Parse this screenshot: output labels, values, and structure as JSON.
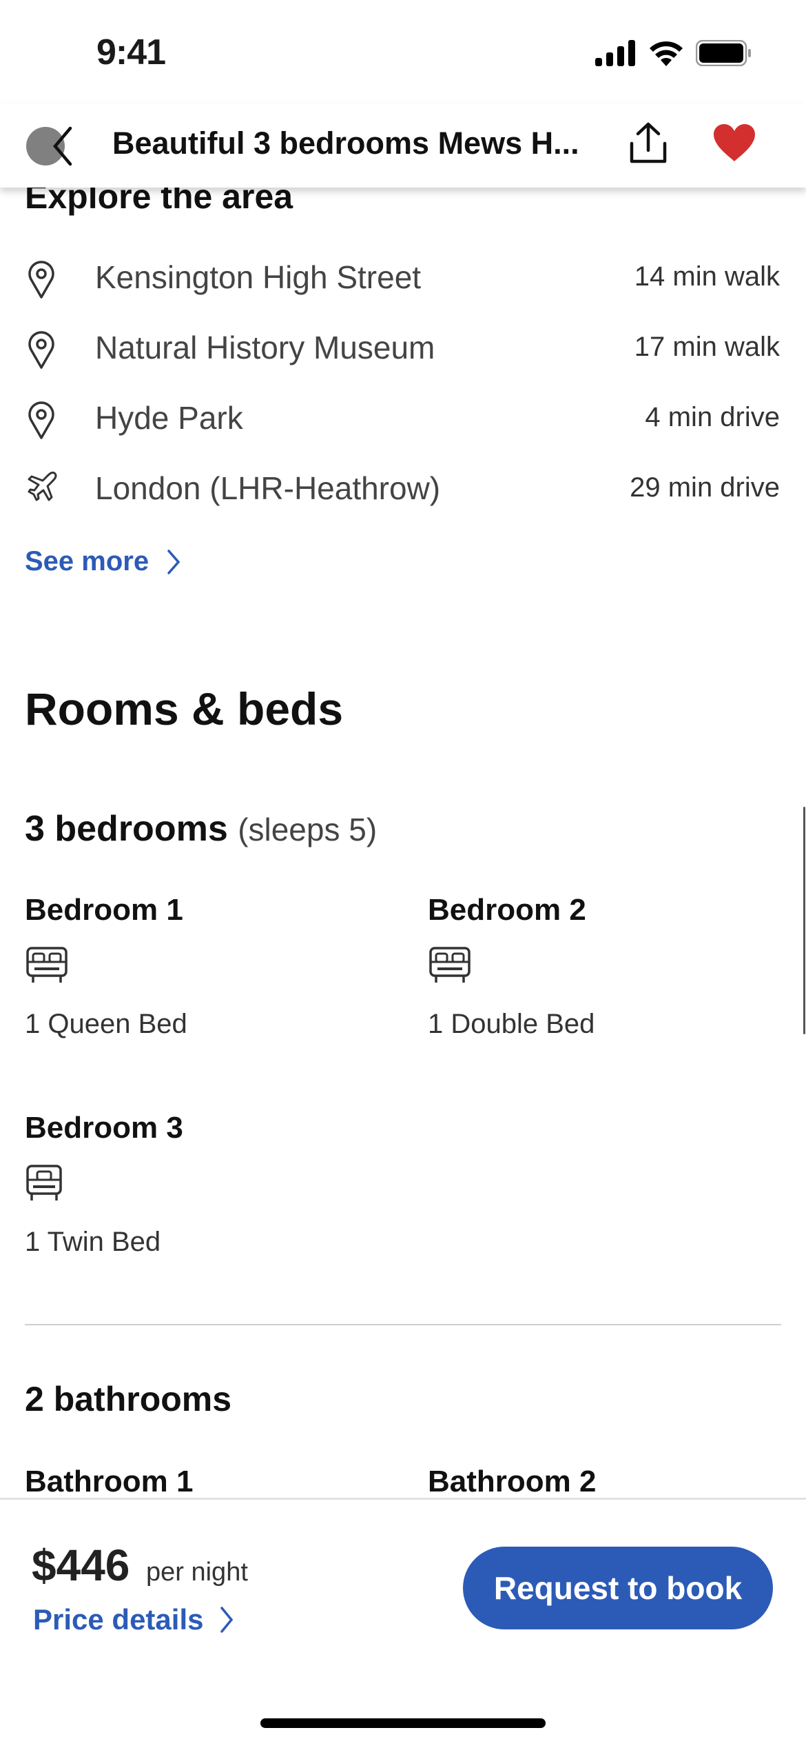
{
  "status_bar": {
    "time": "9:41",
    "icons": [
      "signal-icon",
      "wifi-icon",
      "battery-icon"
    ]
  },
  "header": {
    "title": "Beautiful 3 bedrooms Mews H...",
    "back_icon": "chevron-left-icon",
    "share_icon": "share-icon",
    "favorite_icon": "heart-icon",
    "favorite_color": "#d32f2f"
  },
  "explore": {
    "title": "Explore the area",
    "places": [
      {
        "icon": "map-pin-icon",
        "name": "Kensington High Street",
        "distance": "14 min walk"
      },
      {
        "icon": "map-pin-icon",
        "name": "Natural History Museum",
        "distance": "17 min walk"
      },
      {
        "icon": "map-pin-icon",
        "name": "Hyde Park",
        "distance": "4 min drive"
      },
      {
        "icon": "airplane-icon",
        "name": "London (LHR-Heathrow)",
        "distance": "29 min drive"
      }
    ],
    "see_more": "See more"
  },
  "rooms": {
    "title": "Rooms & beds",
    "bedrooms_heading": "3 bedrooms",
    "sleeps": "(sleeps 5)",
    "bedrooms": [
      {
        "name": "Bedroom 1",
        "icon": "double-bed-icon",
        "beds": "1 Queen Bed"
      },
      {
        "name": "Bedroom 2",
        "icon": "double-bed-icon",
        "beds": "1 Double Bed"
      },
      {
        "name": "Bedroom 3",
        "icon": "single-bed-icon",
        "beds": "1 Twin Bed"
      }
    ],
    "bathrooms_heading": "2 bathrooms",
    "bathrooms": [
      {
        "name": "Bathroom 1"
      },
      {
        "name": "Bathroom 2"
      }
    ]
  },
  "booking": {
    "price": "$446",
    "per": "per night",
    "price_details": "Price details",
    "cta": "Request to book",
    "accent_color": "#2c5bb7"
  }
}
